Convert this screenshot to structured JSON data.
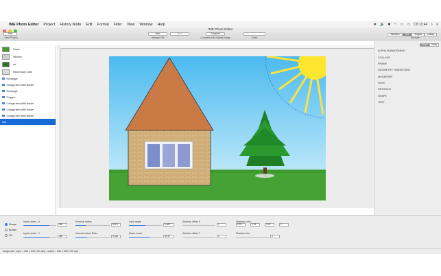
{
  "menubar": {
    "items": [
      "IME Photo Editor",
      "Project",
      "History Node",
      "Edit",
      "Format",
      "Filter",
      "View",
      "Window",
      "Help"
    ],
    "clock": "Сб 11:44"
  },
  "window": {
    "title": "IME Photo Editor",
    "toolbar": {
      "new_project": "New",
      "save_project": "Save Project",
      "new_file": "New",
      "open": "Open",
      "manage_file": "Manage File",
      "compare": "Compare",
      "compare_label": "Compare with original image",
      "zoom_label": "Zoom",
      "tools": [
        "Selection",
        "Text",
        "Shapes",
        "Library"
      ],
      "tool_type_label": "Tool type"
    }
  },
  "layers": {
    "items": [
      {
        "label": "Grass",
        "kind": "thumb",
        "color": "#4a9a2a"
      },
      {
        "label": "Window",
        "kind": "thumb",
        "color": "#cfcfcf"
      },
      {
        "label": "ref",
        "kind": "thumb",
        "color": "#2f6f2a"
      },
      {
        "label": "New history node",
        "kind": "thumb",
        "color": "#dcdcdc"
      },
      {
        "label": "Rectangle",
        "kind": "check"
      },
      {
        "label": "Collage item With Border",
        "kind": "check"
      },
      {
        "label": "Rectangle",
        "kind": "check"
      },
      {
        "label": "Polygon",
        "kind": "check"
      },
      {
        "label": "Collage item With Border",
        "kind": "check"
      },
      {
        "label": "Collage item With Border",
        "kind": "check"
      },
      {
        "label": "Collage item With Border",
        "kind": "check"
      },
      {
        "label": "Star",
        "kind": "selected"
      }
    ]
  },
  "effects": {
    "tabs": [
      "Single",
      "Multy"
    ],
    "items": [
      "ALPHA MANAGEMENT",
      "COLLAGE",
      "FRAME",
      "GEOMETRY TRANSFORM",
      "MAGNIFIER",
      "NOTE",
      "RETOUCH",
      "SHAPE",
      "TEXT"
    ]
  },
  "shape_options": {
    "radios": [
      "Shape",
      "Border",
      "Fill"
    ],
    "controls": [
      {
        "label": "Input center - X",
        "value": "360"
      },
      {
        "label": "External radius",
        "value": "202.0"
      },
      {
        "label": "Input angle",
        "value": "0.387°"
      },
      {
        "label": "Shadow offset X",
        "value": "0"
      },
      {
        "label": "Shadow color",
        "values": [
          "0.75",
          "0.75",
          "0.75",
          "1"
        ]
      },
      {
        "label": "Input center - Y",
        "value": "360"
      },
      {
        "label": "Internal radius Ratio",
        "value": "0.344"
      },
      {
        "label": "Beam count",
        "value": "30.37"
      },
      {
        "label": "Shadow offset Y",
        "value": "0"
      },
      {
        "label": "Shadow blur",
        "value": "0"
      }
    ]
  },
  "status": "Image size: input – 960 x 590 (720 dpi) , output – 960 x 590 (720 dpi)",
  "colors": {
    "accent": "#1769d6",
    "sky_top": "#5ec1ee",
    "grass": "#3f9a2e"
  }
}
